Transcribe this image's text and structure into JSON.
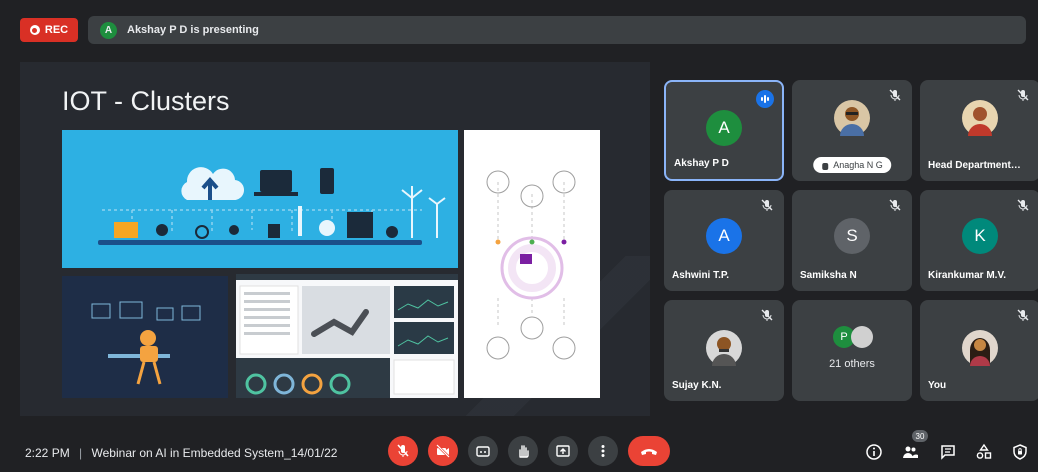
{
  "top": {
    "rec_label": "REC",
    "presenter_initial": "A",
    "presenting_text": "Akshay P D is presenting"
  },
  "slide": {
    "title": "IOT - Clusters"
  },
  "participants": [
    {
      "name": "Akshay P D",
      "initial": "A",
      "avatar_color": "#1e8e3e",
      "speaking": true
    },
    {
      "name": "Anagha N G",
      "photo": true
    },
    {
      "name": "Head Department…",
      "photo": true
    },
    {
      "name": "Ashwini T.P.",
      "initial": "A",
      "avatar_color": "#1a73e8"
    },
    {
      "name": "Samiksha N",
      "initial": "S",
      "avatar_color": "#5f6368"
    },
    {
      "name": "Kirankumar M.V.",
      "initial": "K",
      "avatar_color": "#00897b"
    },
    {
      "name": "Sujay K.N.",
      "photo": true
    },
    {
      "others_initial": "P",
      "others_label": "21 others"
    },
    {
      "name": "You",
      "photo": true
    }
  ],
  "bottom": {
    "time": "2:22 PM",
    "separator": "|",
    "meeting_title": "Webinar on AI in Embedded System_14/01/22",
    "people_count": "30"
  },
  "colors": {
    "background": "#202124",
    "tile": "#3c4043",
    "danger": "#ea4335",
    "accent": "#1a73e8"
  }
}
